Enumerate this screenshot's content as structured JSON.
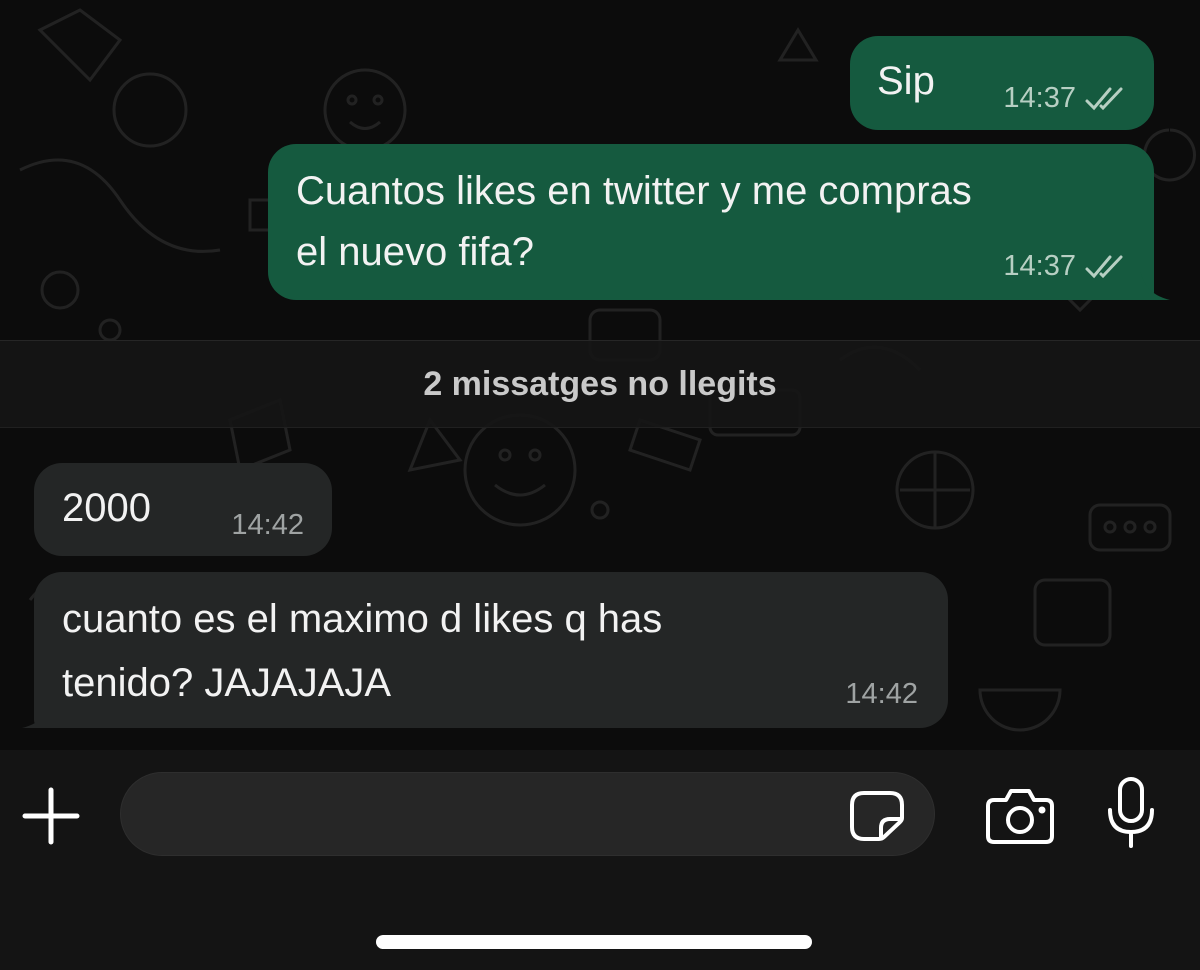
{
  "messages": [
    {
      "direction": "out",
      "text_lines": [
        "Sip"
      ],
      "time": "14:37",
      "status": "read"
    },
    {
      "direction": "out",
      "text_lines": [
        "Cuantos likes en twitter y me compras",
        "el nuevo fifa?"
      ],
      "time": "14:37",
      "status": "read"
    },
    {
      "direction": "in",
      "text_lines": [
        "2000"
      ],
      "time": "14:42"
    },
    {
      "direction": "in",
      "text_lines": [
        "cuanto es el maximo d likes q has",
        "tenido? JAJAJAJA"
      ],
      "time": "14:42"
    }
  ],
  "unread_banner": "2 missatges no llegits",
  "input": {
    "value": "",
    "placeholder": ""
  },
  "icons": {
    "attach": "plus-icon",
    "sticker": "sticker-icon",
    "camera": "camera-icon",
    "mic": "microphone-icon",
    "read_status": "double-check-icon"
  },
  "colors": {
    "outgoing_bubble": "#155a3f",
    "incoming_bubble": "#242626",
    "background": "#0b0b0b",
    "text": "#f2f2f2"
  }
}
